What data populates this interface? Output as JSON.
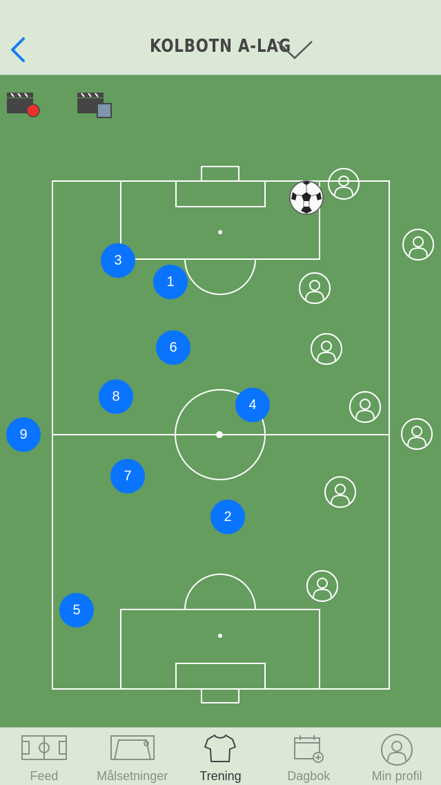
{
  "header": {
    "title": "KOLBOTN A-LAG",
    "back_icon": "chevron-left-icon",
    "dropdown_icon": "chevron-down-icon"
  },
  "toolbar": {
    "record_button": "video-record-icon",
    "stop_button": "video-stop-icon"
  },
  "players": [
    {
      "number": "3"
    },
    {
      "number": "1"
    },
    {
      "number": "6"
    },
    {
      "number": "8"
    },
    {
      "number": "4"
    },
    {
      "number": "9"
    },
    {
      "number": "7"
    },
    {
      "number": "2"
    },
    {
      "number": "5"
    }
  ],
  "opponent_icon": "person-icon",
  "ball_icon": "soccer-ball-icon",
  "tabs": [
    {
      "label": "Feed",
      "icon": "field-icon",
      "active": false
    },
    {
      "label": "Målsetninger",
      "icon": "goal-icon",
      "active": false
    },
    {
      "label": "Trening",
      "icon": "jersey-icon",
      "active": true
    },
    {
      "label": "Dagbok",
      "icon": "calendar-icon",
      "active": false
    },
    {
      "label": "Min profil",
      "icon": "profile-icon",
      "active": false
    }
  ],
  "colors": {
    "accent": "#0a74ff",
    "field": "#649d5e",
    "bar": "#dbe8d6"
  }
}
